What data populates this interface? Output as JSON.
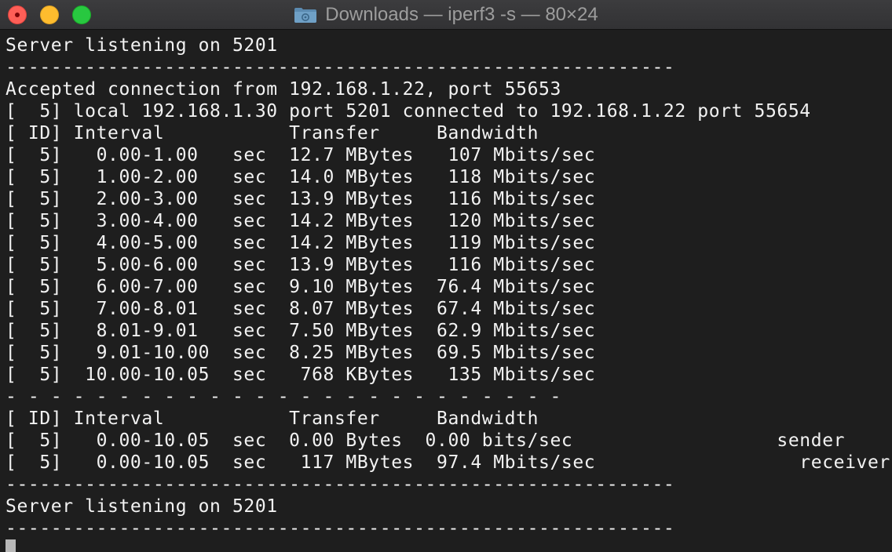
{
  "window": {
    "title": "Downloads — iperf3 -s — 80×24",
    "controls": {
      "close": "close-button",
      "minimize": "minimize-button",
      "zoom": "zoom-button"
    },
    "folder_icon": "folder-icon"
  },
  "terminal": {
    "lines": [
      "Server listening on 5201",
      "-----------------------------------------------------------",
      "Accepted connection from 192.168.1.22, port 55653",
      "[  5] local 192.168.1.30 port 5201 connected to 192.168.1.22 port 55654",
      "[ ID] Interval           Transfer     Bandwidth",
      "[  5]   0.00-1.00   sec  12.7 MBytes   107 Mbits/sec",
      "[  5]   1.00-2.00   sec  14.0 MBytes   118 Mbits/sec",
      "[  5]   2.00-3.00   sec  13.9 MBytes   116 Mbits/sec",
      "[  5]   3.00-4.00   sec  14.2 MBytes   120 Mbits/sec",
      "[  5]   4.00-5.00   sec  14.2 MBytes   119 Mbits/sec",
      "[  5]   5.00-6.00   sec  13.9 MBytes   116 Mbits/sec",
      "[  5]   6.00-7.00   sec  9.10 MBytes  76.4 Mbits/sec",
      "[  5]   7.00-8.01   sec  8.07 MBytes  67.4 Mbits/sec",
      "[  5]   8.01-9.01   sec  7.50 MBytes  62.9 Mbits/sec",
      "[  5]   9.01-10.00  sec  8.25 MBytes  69.5 Mbits/sec",
      "[  5]  10.00-10.05  sec   768 KBytes   135 Mbits/sec",
      "- - - - - - - - - - - - - - - - - - - - - - - - -",
      "[ ID] Interval           Transfer     Bandwidth",
      "[  5]   0.00-10.05  sec  0.00 Bytes  0.00 bits/sec                  sender",
      "[  5]   0.00-10.05  sec   117 MBytes  97.4 Mbits/sec                  receiver",
      "-----------------------------------------------------------",
      "Server listening on 5201",
      "-----------------------------------------------------------"
    ],
    "colors": {
      "background": "#1e1e1e",
      "text": "#f2f2f2",
      "cursor": "#b9b9b9"
    }
  }
}
